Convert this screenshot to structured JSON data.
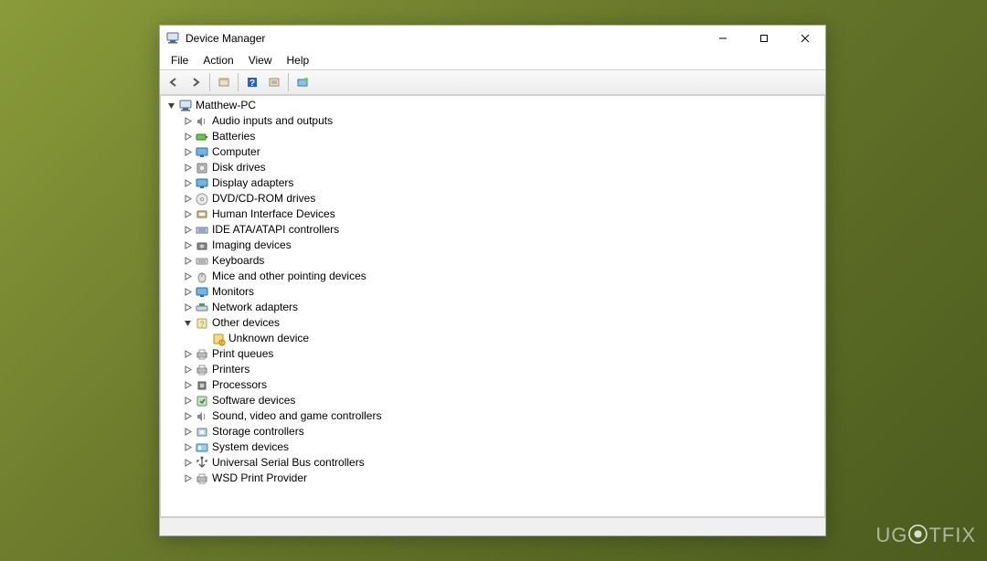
{
  "window": {
    "title": "Device Manager"
  },
  "menu": {
    "file": "File",
    "action": "Action",
    "view": "View",
    "help": "Help"
  },
  "toolbar": {
    "back": "back",
    "forward": "forward",
    "show_hidden": "show-hidden",
    "help": "help",
    "properties": "properties",
    "scan": "scan-for-hardware-changes"
  },
  "tree": {
    "root": "Matthew-PC",
    "items": [
      {
        "label": "Audio inputs and outputs",
        "icon": "speaker"
      },
      {
        "label": "Batteries",
        "icon": "battery"
      },
      {
        "label": "Computer",
        "icon": "monitor"
      },
      {
        "label": "Disk drives",
        "icon": "disk"
      },
      {
        "label": "Display adapters",
        "icon": "monitor"
      },
      {
        "label": "DVD/CD-ROM drives",
        "icon": "disc"
      },
      {
        "label": "Human Interface Devices",
        "icon": "hid"
      },
      {
        "label": "IDE ATA/ATAPI controllers",
        "icon": "ide"
      },
      {
        "label": "Imaging devices",
        "icon": "camera"
      },
      {
        "label": "Keyboards",
        "icon": "keyboard"
      },
      {
        "label": "Mice and other pointing devices",
        "icon": "mouse"
      },
      {
        "label": "Monitors",
        "icon": "monitor"
      },
      {
        "label": "Network adapters",
        "icon": "network"
      },
      {
        "label": "Other devices",
        "icon": "other",
        "expanded": true,
        "children": [
          {
            "label": "Unknown device",
            "icon": "unknown"
          }
        ]
      },
      {
        "label": "Print queues",
        "icon": "printer"
      },
      {
        "label": "Printers",
        "icon": "printer"
      },
      {
        "label": "Processors",
        "icon": "cpu"
      },
      {
        "label": "Software devices",
        "icon": "software"
      },
      {
        "label": "Sound, video and game controllers",
        "icon": "speaker"
      },
      {
        "label": "Storage controllers",
        "icon": "storage"
      },
      {
        "label": "System devices",
        "icon": "system"
      },
      {
        "label": "Universal Serial Bus controllers",
        "icon": "usb"
      },
      {
        "label": "WSD Print Provider",
        "icon": "printer"
      }
    ]
  },
  "watermark": {
    "text": "UG   FIX",
    "accent": "ET"
  }
}
